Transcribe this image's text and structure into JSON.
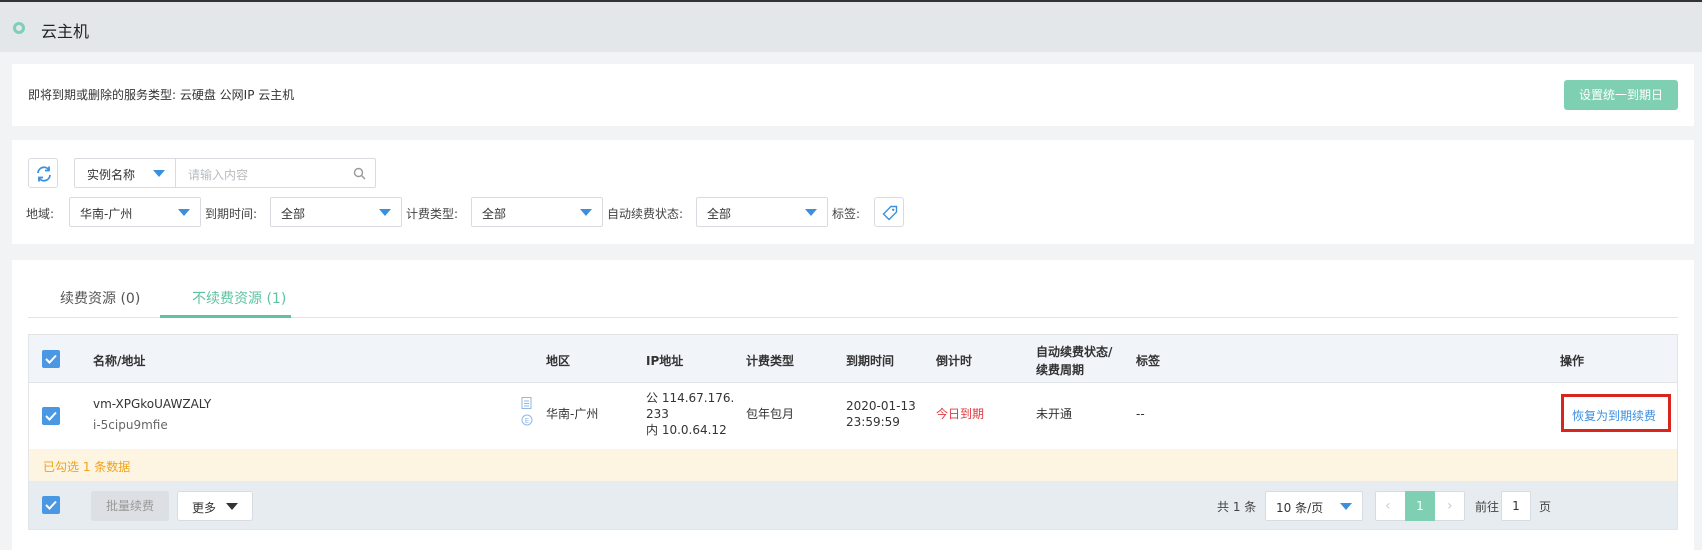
{
  "header": {
    "title": "云主机"
  },
  "notice": {
    "text": "即将到期或删除的服务类型: 云硬盘 公网IP 云主机",
    "button": "设置统一到期日"
  },
  "filters": {
    "search_field": "实例名称",
    "search_placeholder": "请输入内容",
    "region_label": "地域:",
    "region_value": "华南-广州",
    "expire_label": "到期时间:",
    "expire_value": "全部",
    "billing_label": "计费类型:",
    "billing_value": "全部",
    "renew_label": "自动续费状态:",
    "renew_value": "全部",
    "tag_label": "标签:"
  },
  "tabs": [
    {
      "label": "续费资源 (0)",
      "active": false
    },
    {
      "label": "不续费资源 (1)",
      "active": true
    }
  ],
  "table": {
    "columns": {
      "name": "名称/地址",
      "region": "地区",
      "ip": "IP地址",
      "billing": "计费类型",
      "expire": "到期时间",
      "countdown": "倒计时",
      "renew_line1": "自动续费状态/",
      "renew_line2": "续费周期",
      "tag": "标签",
      "action": "操作"
    },
    "rows": [
      {
        "name": "vm-XPGkoUAWZALY",
        "id": "i-5cipu9mfie",
        "region": "华南-广州",
        "ip_public_1": "公 114.67.176.",
        "ip_public_2": "233",
        "ip_private": "内 10.0.64.12",
        "billing": "包年包月",
        "expire_date": "2020-01-13",
        "expire_time": "23:59:59",
        "countdown": "今日到期",
        "renew": "未开通",
        "tag": "--",
        "action": "恢复为到期续费"
      }
    ],
    "selected_text": "已勾选 1 条数据"
  },
  "footer": {
    "batch_button": "批量续费",
    "more_button": "更多",
    "total": "共 1 条",
    "page_size": "10 条/页",
    "current_page": "1",
    "goto_label": "前往",
    "goto_value": "1",
    "page_unit": "页"
  },
  "colors": {
    "accent_green": "#7fd0b2",
    "link_blue": "#3b8fe0",
    "warning_red": "#e0393e",
    "highlight_box": "#d9261c"
  }
}
